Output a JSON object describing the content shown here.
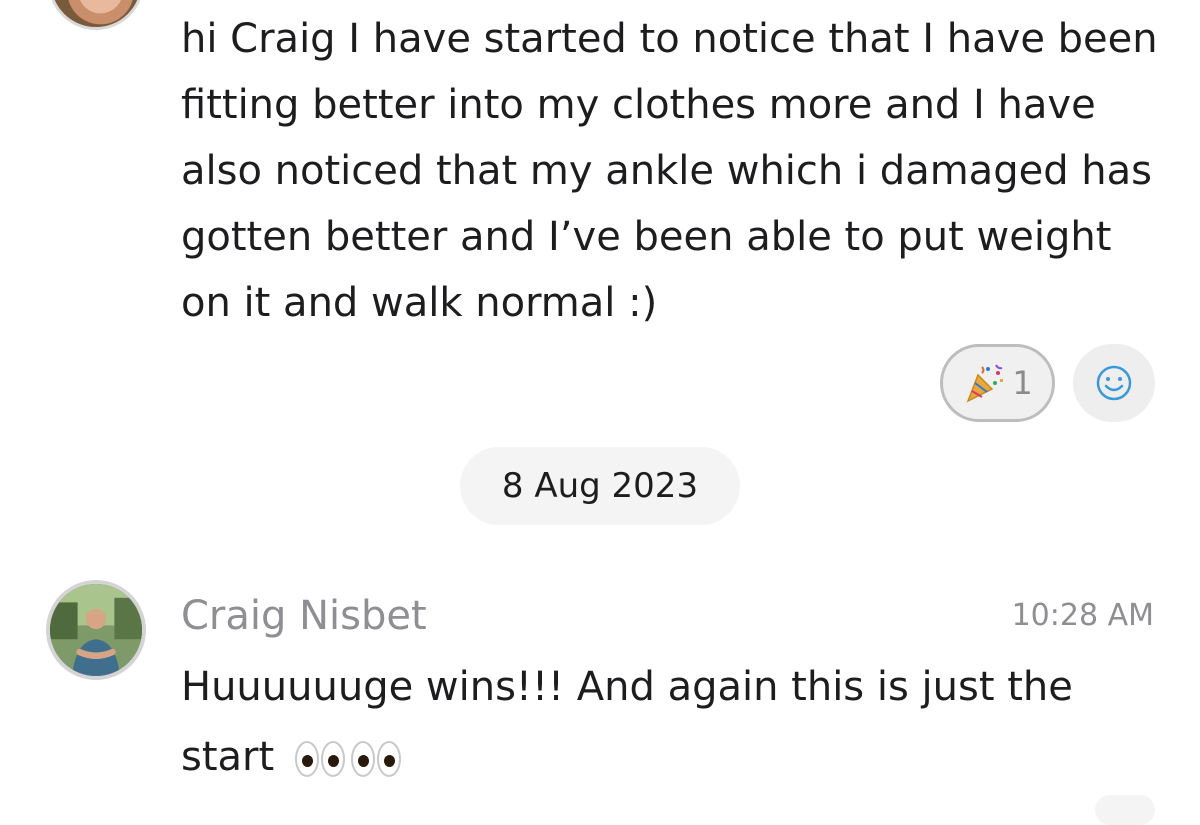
{
  "messages": [
    {
      "text": "hi Craig I have started to notice that I have been fitting better into my clothes more and I have also noticed that my ankle which i damaged has gotten better and I’ve been able to put weight on it and walk normal :)",
      "reactions": [
        {
          "icon": "party-popper-icon",
          "count": "1"
        }
      ],
      "add_reaction_icon": "smiley-face-icon"
    },
    {
      "sender": "Craig Nisbet",
      "time": "10:28 AM",
      "text": "Huuuuuuge wins!!! And again this is just the start",
      "emoji": "eyes-emoji"
    }
  ],
  "date_separator": "8 Aug 2023"
}
